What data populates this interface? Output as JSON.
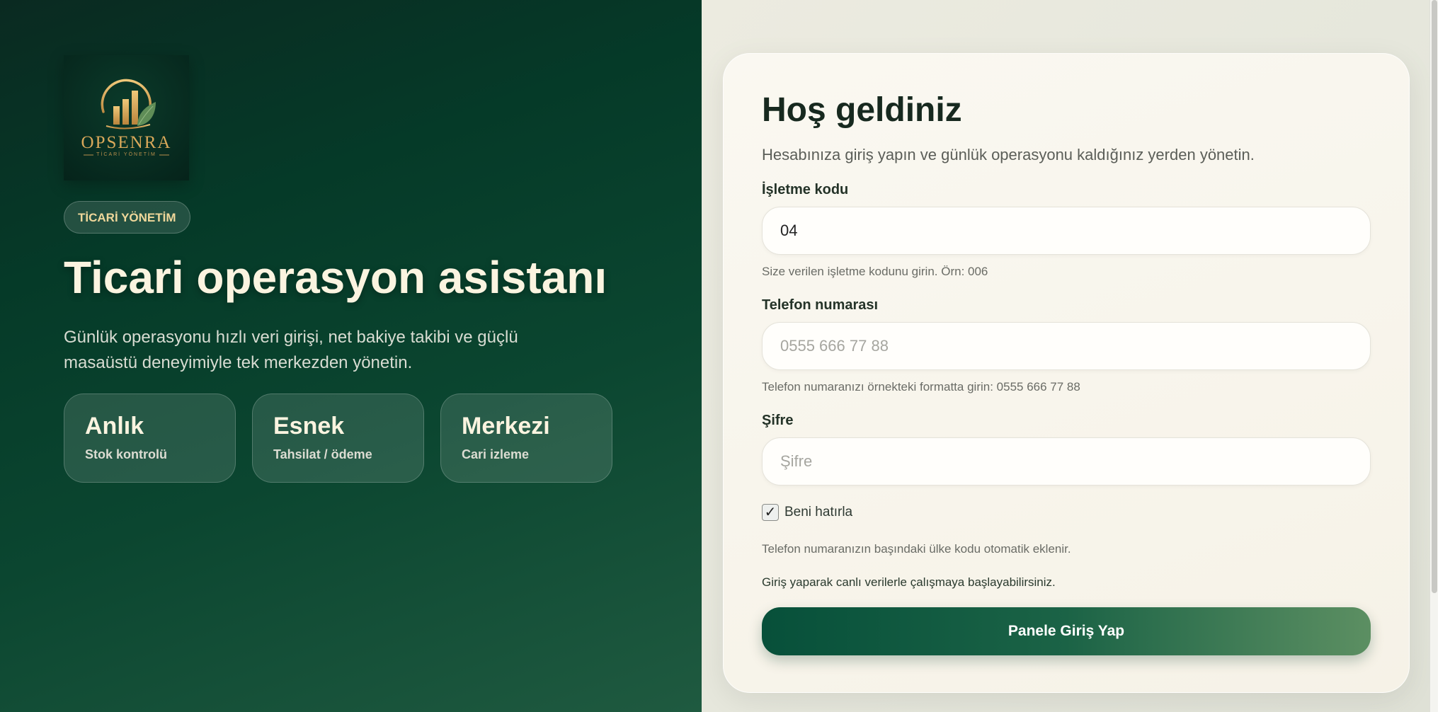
{
  "brand": {
    "logo_name": "OPSENRA",
    "logo_subtitle": "TİCARİ YÖNETİM",
    "badge": "TİCARİ YÖNETİM",
    "gold": "#d8a85a",
    "green": "#6b9a5c"
  },
  "hero": {
    "title": "Ticari operasyon asistanı",
    "subtitle": "Günlük operasyonu hızlı veri girişi, net bakiye takibi ve güçlü masaüstü deneyimiyle tek merkezden yönetin."
  },
  "features": [
    {
      "title": "Anlık",
      "subtitle": "Stok kontrolü"
    },
    {
      "title": "Esnek",
      "subtitle": "Tahsilat / ödeme"
    },
    {
      "title": "Merkezi",
      "subtitle": "Cari izleme"
    }
  ],
  "form": {
    "title": "Hoş geldiniz",
    "subtitle": "Hesabınıza giriş yapın ve günlük operasyonu kaldığınız yerden yönetin.",
    "business_code": {
      "label": "İşletme kodu",
      "value": "04",
      "hint": "Size verilen işletme kodunu girin. Örn: 006"
    },
    "phone": {
      "label": "Telefon numarası",
      "placeholder": "0555 666 77 88",
      "hint": "Telefon numaranızı örnekteki formatta girin: 0555 666 77 88"
    },
    "password": {
      "label": "Şifre",
      "placeholder": "Şifre"
    },
    "remember": {
      "label": "Beni hatırla",
      "checked": true
    },
    "note_country_code": "Telefon numaranızın başındaki ülke kodu otomatik eklenir.",
    "note_live": "Giriş yaparak canlı verilerle çalışmaya başlayabilirsiniz.",
    "submit_label": "Panele Giriş Yap"
  }
}
